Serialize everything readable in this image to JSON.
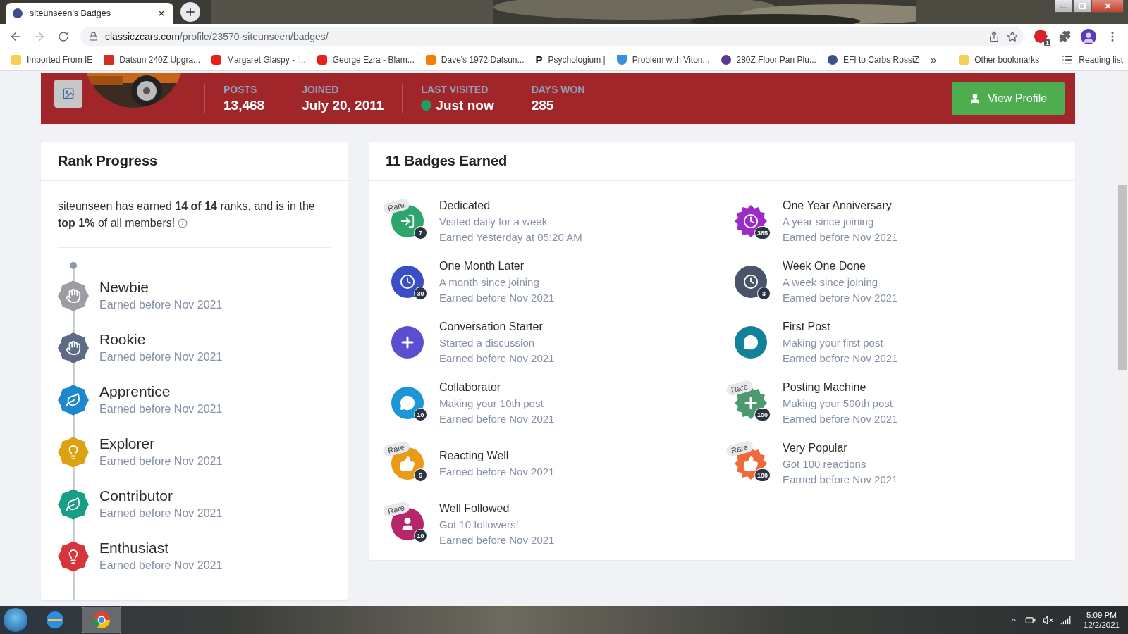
{
  "browser": {
    "tab": {
      "title": "siteunseen's Badges",
      "selected": true
    },
    "url": {
      "host": "classiczcars.com",
      "path": "/profile/23570-siteunseen/badges/"
    },
    "extension_count": "1",
    "bookmarks": [
      {
        "label": "Imported From IE"
      },
      {
        "label": "Datsun 240Z Upgra..."
      },
      {
        "label": "Margaret Glaspy - '..."
      },
      {
        "label": "George Ezra - Blam..."
      },
      {
        "label": "Dave's 1972 Datsun..."
      },
      {
        "label": "Psychologium |",
        "letter": "P"
      },
      {
        "label": "Problem with Viton..."
      },
      {
        "label": "280Z Floor Pan Plu..."
      },
      {
        "label": "EFI to Carbs RossiZ"
      }
    ],
    "overflow": "»",
    "other_bookmarks": "Other bookmarks",
    "reading_list": "Reading list"
  },
  "profile": {
    "stats": [
      {
        "label": "POSTS",
        "value": "13,468"
      },
      {
        "label": "JOINED",
        "value": "July 20, 2011"
      },
      {
        "label": "LAST VISITED",
        "value": "Just now",
        "online": true
      },
      {
        "label": "DAYS WON",
        "value": "285"
      }
    ],
    "view_profile": "View Profile"
  },
  "rank_progress": {
    "title": "Rank Progress",
    "summary": "siteunseen has earned **14 of 14** ranks, and is in the **top 1%** of all members!",
    "ranks": [
      {
        "name": "Newbie",
        "earned": "Earned before Nov 2021",
        "color": "#9b9da3"
      },
      {
        "name": "Rookie",
        "earned": "Earned before Nov 2021",
        "color": "#5d6b86"
      },
      {
        "name": "Apprentice",
        "earned": "Earned before Nov 2021",
        "color": "#1e88cf"
      },
      {
        "name": "Explorer",
        "earned": "Earned before Nov 2021",
        "color": "#dca214"
      },
      {
        "name": "Contributor",
        "earned": "Earned before Nov 2021",
        "color": "#169e86"
      },
      {
        "name": "Enthusiast",
        "earned": "Earned before Nov 2021",
        "color": "#d8343c"
      }
    ]
  },
  "badges": {
    "title": "11 Badges Earned",
    "items": [
      {
        "name": "Dedicated",
        "description": "Visited daily for a week",
        "earned": "Earned Yesterday at 05:20 AM",
        "tag": "Rare",
        "count": "7",
        "color": "#2ea56c"
      },
      {
        "name": "One Year Anniversary",
        "description": "A year since joining",
        "earned": "Earned before Nov 2021",
        "count": "365",
        "color": "#9b2cc6"
      },
      {
        "name": "One Month Later",
        "description": "A month since joining",
        "earned": "Earned before Nov 2021",
        "count": "30",
        "color": "#3a4ec6"
      },
      {
        "name": "Week One Done",
        "description": "A week since joining",
        "earned": "Earned before Nov 2021",
        "count": "3",
        "color": "#4a5468"
      },
      {
        "name": "Conversation Starter",
        "description": "Started a discussion",
        "earned": "Earned before Nov 2021",
        "color": "#5a4fcf"
      },
      {
        "name": "First Post",
        "description": "Making your first post",
        "earned": "Earned before Nov 2021",
        "color": "#11829a"
      },
      {
        "name": "Collaborator",
        "description": "Making your 10th post",
        "earned": "Earned before Nov 2021",
        "count": "10",
        "color": "#1d96d8"
      },
      {
        "name": "Posting Machine",
        "description": "Making your 500th post",
        "earned": "Earned before Nov 2021",
        "tag": "Rare",
        "count": "100",
        "color": "#4c9a6e"
      },
      {
        "name": "Reacting Well",
        "earned": "Earned before Nov 2021",
        "tag": "Rare",
        "count": "5",
        "color": "#e89a18"
      },
      {
        "name": "Very Popular",
        "description": "Got 100 reactions",
        "earned": "Earned before Nov 2021",
        "tag": "Rare",
        "count": "100",
        "color": "#ee6a3a"
      },
      {
        "name": "Well Followed",
        "description": "Got 10 followers!",
        "earned": "Earned before Nov 2021",
        "tag": "Rare",
        "count": "10",
        "color": "#b8266a"
      }
    ]
  },
  "taskbar": {
    "time": "5:09 PM",
    "date": "12/2/2021"
  }
}
